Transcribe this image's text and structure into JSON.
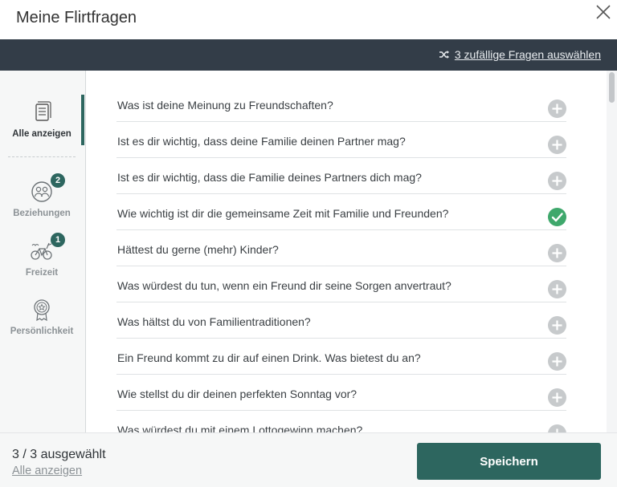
{
  "header": {
    "title": "Meine Flirtfragen"
  },
  "toolbar": {
    "random_label": "3 zufällige Fragen auswählen"
  },
  "sidebar": {
    "items": [
      {
        "label": "Alle anzeigen"
      },
      {
        "label": "Beziehungen",
        "badge": "2"
      },
      {
        "label": "Freizeit",
        "badge": "1"
      },
      {
        "label": "Persönlichkeit"
      }
    ]
  },
  "questions": [
    {
      "text": "Was ist deine Meinung zu Freundschaften?",
      "selected": false
    },
    {
      "text": "Ist es dir wichtig, dass deine Familie deinen Partner mag?",
      "selected": false
    },
    {
      "text": "Ist es dir wichtig, dass die Familie deines Partners dich mag?",
      "selected": false
    },
    {
      "text": "Wie wichtig ist dir die gemeinsame Zeit mit Familie und Freunden?",
      "selected": true
    },
    {
      "text": "Hättest du gerne (mehr) Kinder?",
      "selected": false
    },
    {
      "text": "Was würdest du tun, wenn ein Freund dir seine Sorgen anvertraut?",
      "selected": false
    },
    {
      "text": "Was hältst du von Familientraditionen?",
      "selected": false
    },
    {
      "text": "Ein Freund kommt zu dir auf einen Drink. Was bietest du an?",
      "selected": false
    },
    {
      "text": "Wie stellst du dir deinen perfekten Sonntag vor?",
      "selected": false
    },
    {
      "text": "Was würdest du mit einem Lottogewinn machen?",
      "selected": false
    }
  ],
  "footer": {
    "count": "3 / 3 ausgewählt",
    "show_all": "Alle anzeigen",
    "save_label": "Speichern"
  },
  "colors": {
    "accent": "#2d665f",
    "toolbar": "#333d48",
    "selected": "#3fa86c",
    "unselected": "#c7cacc"
  }
}
